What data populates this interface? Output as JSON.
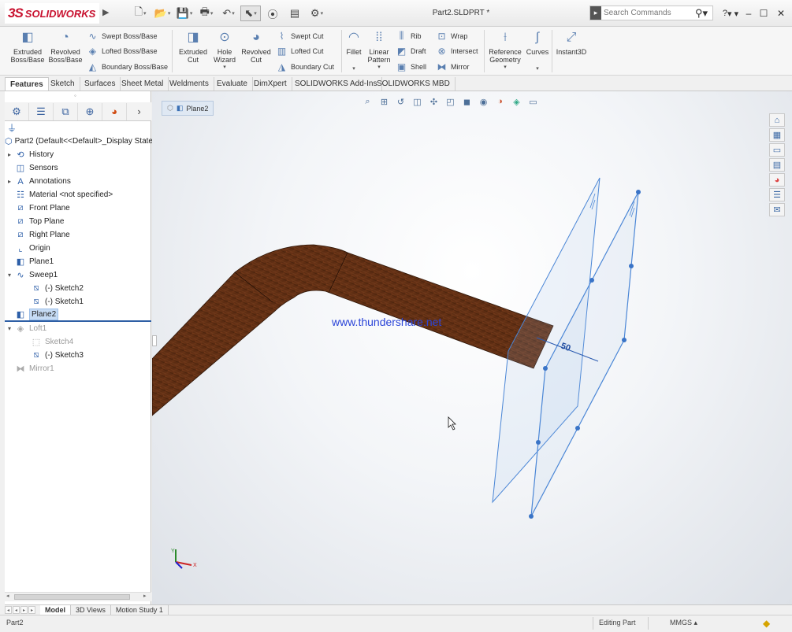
{
  "app": {
    "logo_ds": "3S",
    "logo_text": "SOLIDWORKS",
    "document_title": "Part2.SLDPRT *"
  },
  "search": {
    "placeholder": "Search Commands"
  },
  "help_label": "?",
  "ribbon": {
    "extruded_boss": "Extruded Boss/Base",
    "revolved_boss": "Revolved Boss/Base",
    "swept_boss": "Swept Boss/Base",
    "lofted_boss": "Lofted Boss/Base",
    "boundary_boss": "Boundary Boss/Base",
    "extruded_cut": "Extruded Cut",
    "hole_wizard": "Hole Wizard",
    "revolved_cut": "Revolved Cut",
    "swept_cut": "Swept Cut",
    "lofted_cut": "Lofted Cut",
    "boundary_cut": "Boundary Cut",
    "fillet": "Fillet",
    "linear_pattern": "Linear Pattern",
    "rib": "Rib",
    "draft": "Draft",
    "shell": "Shell",
    "wrap": "Wrap",
    "intersect": "Intersect",
    "mirror": "Mirror",
    "reference_geometry": "Reference Geometry",
    "curves": "Curves",
    "instant3d": "Instant3D"
  },
  "command_tabs": [
    "Features",
    "Sketch",
    "Surfaces",
    "Sheet Metal",
    "Weldments",
    "Evaluate",
    "DimXpert",
    "SOLIDWORKS Add-Ins",
    "SOLIDWORKS MBD"
  ],
  "tree": {
    "root": "Part2  (Default<<Default>_Display State",
    "items": [
      "History",
      "Sensors",
      "Annotations",
      "Material <not specified>",
      "Front Plane",
      "Top Plane",
      "Right Plane",
      "Origin",
      "Plane1",
      "Sweep1",
      "(-) Sketch2",
      "(-) Sketch1",
      "Plane2",
      "Loft1",
      "Sketch4",
      "(-) Sketch3",
      "Mirror1"
    ]
  },
  "viewport": {
    "breadcrumb": "Plane2",
    "watermark": "www.thundershare.net",
    "dimension_value": "50",
    "axis_y": "Y",
    "axis_x": "X"
  },
  "bottom_tabs": [
    "Model",
    "3D Views",
    "Motion Study 1"
  ],
  "status": {
    "left": "Part2",
    "mode": "Editing Part",
    "units": "MMGS"
  },
  "colors": {
    "accent": "#c8102e",
    "plane_blue": "#4a86d6",
    "wood_dark": "#4a2410",
    "wood_light": "#7a3d1c"
  }
}
